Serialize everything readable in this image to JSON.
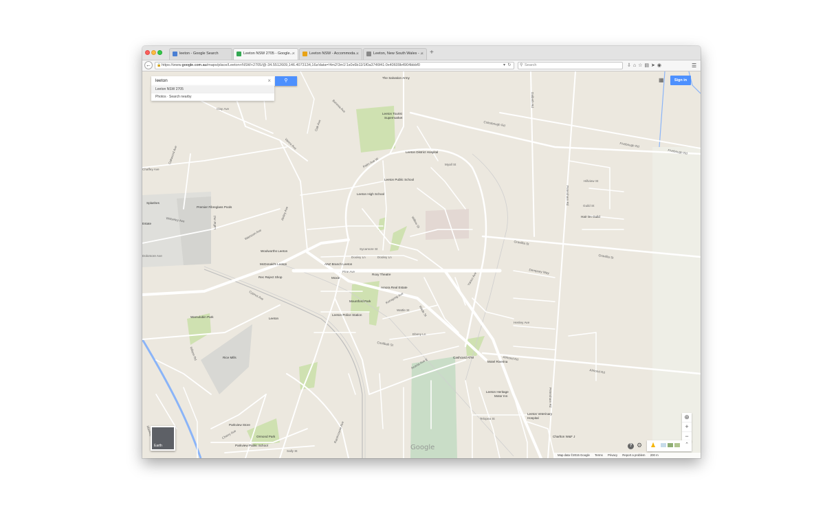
{
  "browser": {
    "tabs": [
      {
        "label": "leeton - Google Search",
        "active": false,
        "favicon_color": "#4a7fd3"
      },
      {
        "label": "Leeton NSW 2705 - Google...",
        "active": true,
        "favicon_color": "#34a853"
      },
      {
        "label": "Leeton NSW - Accommoda...",
        "active": false,
        "favicon_color": "#e8a317"
      },
      {
        "label": "Leeton, New South Wales - ...",
        "active": false,
        "favicon_color": "#888888"
      }
    ],
    "new_tab": "+",
    "url_prefix": "https://www.",
    "url_host": "google.com.au",
    "url_rest": "/maps/place/Leeton+NSW+2705/@-34.5512609,146.4073134,16z/data=!4m2!3m1!1s0x6b11f1f0a3746f41:0x40609b4904bbbf0",
    "search_placeholder": "Search"
  },
  "map": {
    "search_value": "leeton",
    "search_button_icon": "magnifier-icon",
    "suggestions": [
      "Leeton NSW 2705",
      "Photos · Search nearby"
    ],
    "signin_label": "Sign in",
    "earth_label": "Earth",
    "zoom_in": "+",
    "zoom_out": "−",
    "google_logo": "Google",
    "footer": {
      "map_data": "Map data ©2015 Google",
      "terms": "Terms",
      "privacy": "Privacy",
      "report": "Report a problem",
      "scale": "200 m"
    },
    "pois": {
      "salvation_army": "The Salvation Army",
      "leeton_tourist": "Leeton Tourist",
      "supermarket": "Supermarket",
      "hospital": "Leeton District Hospital",
      "public_school": "Leeton Public School",
      "high_school": "Leeton High School",
      "premier_fibreglass": "Premier Fibreglass Pools",
      "woolworths": "Woolworths Leeton",
      "mcdonalds": "McDonald's Leeton",
      "anz": "ANZ Branch Leeton",
      "roxy": "Roxy Theatre",
      "moxie": "Moxie",
      "amora": "Amora Real Estate",
      "mountford": "Mountford Park",
      "police": "Leeton Police Station",
      "leeton_station": "Leeton",
      "rec_reject": "Rec Reject Shop",
      "wamulubin": "Wamulubin Park",
      "rice_mills": "Rice Mills",
      "cashcard": "Cashcard ATM",
      "motel_riverina": "Motel Riverina",
      "heritage_motor": "Leeton Heritage",
      "heritage_motor_2": "Motor Inn",
      "vet": "Leeton Veterinary",
      "vet_2": "Hospital",
      "charlton": "Charlton W&F J",
      "parkview_store": "Parkview Store",
      "parkview_school": "Parkview Public School",
      "ormond": "Ormond Park",
      "hair_guild": "Hair On Guild",
      "splashes": "Splashes",
      "estate": "Estate"
    },
    "streets": {
      "clay": "Clay Ave",
      "oakwood": "Oakwood Ave",
      "chaffey": "Chaffey Ave",
      "wolseley": "Wolseley Ave",
      "wamoon": "Wamoon Ave",
      "dolomore": "Dolomore Ave",
      "palm1": "Palm Ave W",
      "pine": "Pine Ave",
      "sycamore": "Sycamore St",
      "dooley": "Dooley Ln",
      "dooley2": "Dooley Ln",
      "wattle": "Wattle St",
      "kurrajong": "Kurrajong Ave",
      "acacia": "Acacia Ave E",
      "eboney": "Ebony Ln",
      "coolibah": "Coolibah St",
      "almond": "Almond Rd",
      "almond2": "Almond Rd",
      "gravillia": "Gravillia St",
      "gravillia2": "Gravillia St",
      "dempsey": "Dempsey Way",
      "colesbough": "Colesbough Rd",
      "fivebough": "Fivebough Rd",
      "fivebough2": "Fivebough Rd",
      "henley": "Henley Ave",
      "hillview": "Hillview St",
      "guild": "Guild St",
      "telopea": "Telopea St",
      "wade": "Wade St",
      "boronia": "Boronia Ave",
      "vance": "Vance Ave",
      "oak": "Oak Ave",
      "myall": "Myall St",
      "willow": "Willow St",
      "racecourse": "Racecourse Ave",
      "petersham": "Petersham Rd",
      "petersham2": "Petersham Rd",
      "dalbeth": "Dalbeth Rd",
      "sally": "Sally St",
      "mackay": "Mackay Ave",
      "cherry": "Cherry Ave",
      "wilson": "Wilson Rd",
      "cyprus": "Cyprus Ave",
      "laffan": "Laffan Rd",
      "ainley": "Ainley Ave",
      "yanco": "Yanco Ave"
    }
  }
}
